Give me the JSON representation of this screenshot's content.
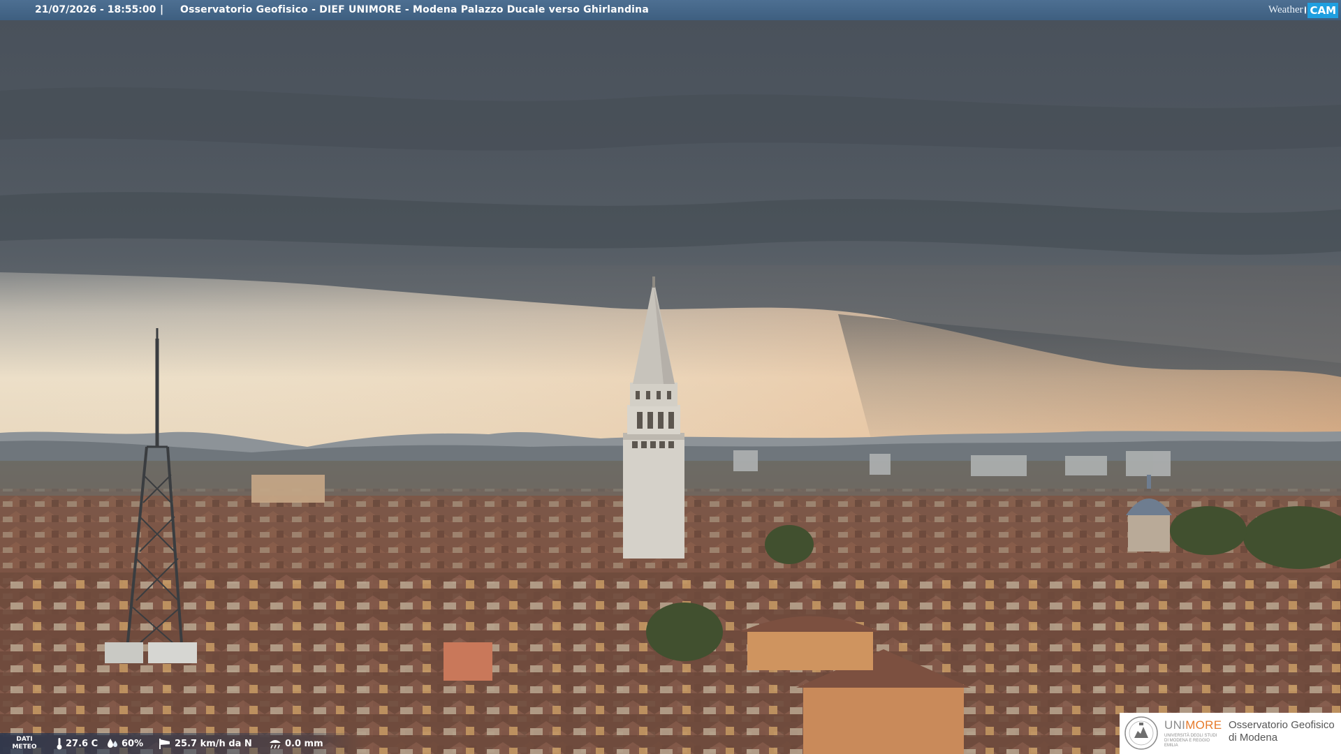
{
  "top_bar": {
    "timestamp": "21/07/2026 - 18:55:00",
    "separator": "|",
    "caption": "Osservatorio Geofisico - DIEF UNIMORE - Modena Palazzo Ducale verso Ghirlandina"
  },
  "watermark": {
    "weather_text": "Weather",
    "cam_text": "CAM",
    "cam_color": "#1f9fe0"
  },
  "meteo": {
    "label": [
      "DATI",
      "METEO"
    ],
    "temperature": "27.6 C",
    "humidity": "60%",
    "wind": "25.7 km/h da N",
    "rain": "0.0 mm",
    "icons": [
      "thermometer-icon",
      "humidity-drops-icon",
      "wind-sock-icon",
      "rain-gauge-icon"
    ]
  },
  "logo": {
    "name_prefix": "UNI",
    "name_accent": "MORE",
    "name_sub": "UNIVERSITÀ DEGLI STUDI DI MODENA E REGGIO EMILIA",
    "observatory_line1": "Osservatorio Geofisico",
    "observatory_line2": "di Modena",
    "accent_color": "#e67a2a"
  },
  "scene": {
    "subject": "Ghirlandina tower",
    "icons": [
      "tower-icon",
      "antenna-mast-icon",
      "dome-icon"
    ]
  }
}
